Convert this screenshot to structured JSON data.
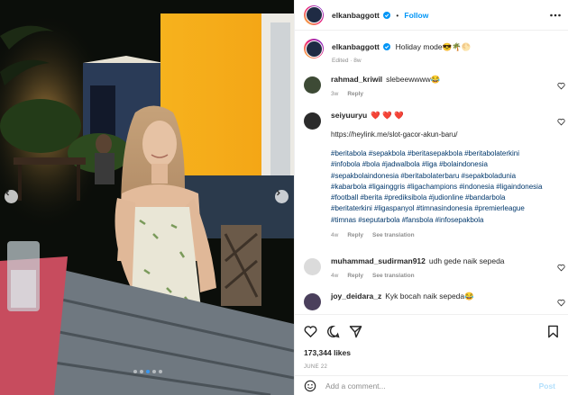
{
  "post": {
    "username": "elkanbaggott",
    "follow_label": "Follow",
    "separator": "•",
    "caption_text": "Holiday mode😎🌴🌕",
    "caption_meta": "Edited · 8w",
    "likes": "173,344 likes",
    "date": "JUNE 22",
    "add_comment_placeholder": "Add a comment...",
    "post_label": "Post",
    "carousel": {
      "slides": 5,
      "active_index": 2
    }
  },
  "comments": [
    {
      "username": "rahmad_kriwil",
      "text": "slebeewwww😂",
      "time": "3w",
      "reply": "Reply"
    },
    {
      "username": "seiyuuryu",
      "text": "❤️ ❤️ ❤️",
      "link": "https://heylink.me/slot-gacor-akun-baru/",
      "hashtags": "#beritabola #sepakbola #beritasepakbola #beritabolaterkini #infobola #bola #jadwalbola #liga #bolaindonesia #sepakbolaindonesia #beritabolaterbaru #sepakboladunia #kabarbola #ligainggris #ligachampions #indonesia #ligaindonesia #football #berita #prediksibola #judionline #bandarbola #beritaterkini #ligaspanyol #timnasindonesia #premierleague #timnas #seputarbola #fansbola #infosepakbola",
      "time": "4w",
      "reply": "Reply",
      "translation": "See translation"
    },
    {
      "username": "muhammad_sudirman912",
      "text": "udh gede naik sepeda",
      "time": "4w",
      "reply": "Reply",
      "translation": "See translation"
    },
    {
      "username": "joy_deidara_z",
      "text": "Kyk bocah naik sepeda😂",
      "time": "",
      "reply": "",
      "translation": ""
    }
  ],
  "icons": {
    "verified": "verified-badge-icon",
    "more": "more-options-icon",
    "like": "heart-icon",
    "comment": "comment-icon",
    "share": "share-icon",
    "save": "bookmark-icon",
    "emoji": "emoji-icon",
    "carousel_prev": "chevron-left-icon",
    "carousel_next": "chevron-right-icon"
  },
  "colors": {
    "accent": "#0095f6",
    "text": "#262626",
    "muted": "#8e8e8e",
    "hashtag": "#00376b",
    "post_disabled": "#b2dffc"
  }
}
